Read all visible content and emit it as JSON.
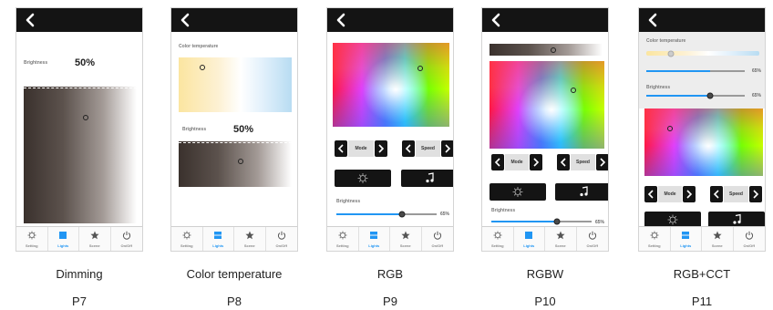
{
  "colors": {
    "accent": "#2196f3",
    "bar": "#141414"
  },
  "labels": {
    "brightness": "Brightness",
    "color_temperature": "Color temperature",
    "mode": "Mode",
    "speed": "Speed"
  },
  "tabs": [
    "Setting",
    "Lights",
    "Scene",
    "On/Off"
  ],
  "icons": [
    "chevron-left-icon",
    "gear-icon",
    "lights-icon",
    "star-icon",
    "power-icon",
    "sun-icon",
    "music-note-icon"
  ],
  "screens": [
    {
      "caption": "Dimming",
      "page": "P7",
      "brightness_value": "50%",
      "brightness_level": 0.5
    },
    {
      "caption": "Color temperature",
      "page": "P8",
      "brightness_value": "50%",
      "brightness_level": 0.5
    },
    {
      "caption": "RGB",
      "page": "P9",
      "brightness_value": "65%",
      "brightness_level": 0.65
    },
    {
      "caption": "RGBW",
      "page": "P10",
      "brightness_value": "65%",
      "brightness_level": 0.65
    },
    {
      "caption": "RGB+CCT",
      "page": "P11",
      "color_temperature_value": "65%",
      "brightness_value": "65%",
      "color_temperature_level": 0.65,
      "brightness_level": 0.65
    }
  ]
}
